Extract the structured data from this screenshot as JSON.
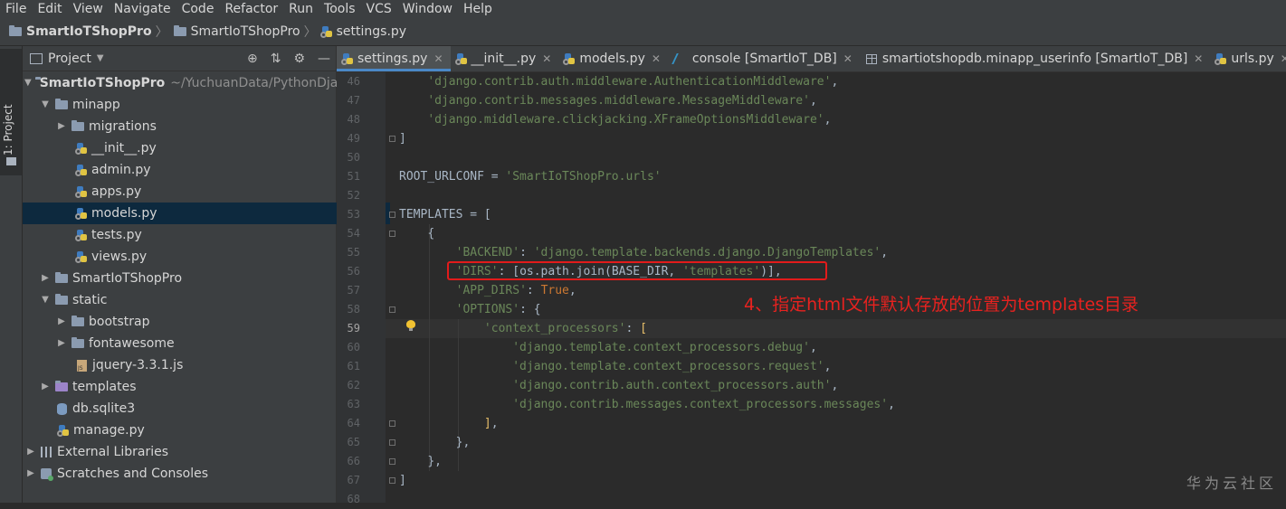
{
  "menu": [
    "File",
    "Edit",
    "View",
    "Navigate",
    "Code",
    "Refactor",
    "Run",
    "Tools",
    "VCS",
    "Window",
    "Help"
  ],
  "breadcrumb": {
    "project": "SmartIoTShopPro",
    "folder": "SmartIoTShopPro",
    "file": "settings.py"
  },
  "tool_strip": {
    "project_tab": "1: Project"
  },
  "project_panel": {
    "title": "Project",
    "root": {
      "name": "SmartIoTShopPro",
      "path": "~/YuchuanData/PythonDjan"
    },
    "items": [
      "minapp",
      "migrations",
      "__init__.py",
      "admin.py",
      "apps.py",
      "models.py",
      "tests.py",
      "views.py",
      "SmartIoTShopPro",
      "static",
      "bootstrap",
      "fontawesome",
      "jquery-3.3.1.js",
      "templates",
      "db.sqlite3",
      "manage.py",
      "External Libraries",
      "Scratches and Consoles"
    ]
  },
  "tabs": [
    "settings.py",
    "__init__.py",
    "models.py",
    "console [SmartIoT_DB]",
    "smartiotshopdb.minapp_userinfo [SmartIoT_DB]",
    "urls.py"
  ],
  "code": {
    "line_numbers": [
      "46",
      "47",
      "48",
      "49",
      "50",
      "51",
      "52",
      "53",
      "54",
      "55",
      "56",
      "57",
      "58",
      "59",
      "60",
      "61",
      "62",
      "63",
      "64",
      "65",
      "66",
      "67",
      "68"
    ],
    "l46": "'django.contrib.auth.middleware.AuthenticationMiddleware'",
    "l47": "'django.contrib.messages.middleware.MessageMiddleware'",
    "l48": "'django.middleware.clickjacking.XFrameOptionsMiddleware'",
    "l49": "]",
    "l51a": "ROOT_URLCONF = ",
    "l51b": "'SmartIoTShopPro.urls'",
    "l53": "TEMPLATES = [",
    "l54": "{",
    "l55a": "'BACKEND'",
    "l55b": "'django.template.backends.django.DjangoTemplates'",
    "l56a": "'DIRS'",
    "l56b": ": [os.path.join(BASE_DIR, ",
    "l56c": "'templates'",
    "l56d": ")],",
    "l57a": "'APP_DIRS'",
    "l57b": ": ",
    "l57c": "True",
    "l58a": "'OPTIONS'",
    "l58b": ": {",
    "l59a": "'context_processors'",
    "l59b": ": ",
    "l59c": "[",
    "l60": "'django.template.context_processors.debug'",
    "l61": "'django.template.context_processors.request'",
    "l62": "'django.contrib.auth.context_processors.auth'",
    "l63": "'django.contrib.messages.context_processors.messages'",
    "l64": "]",
    "l65": "},",
    "l66": "},",
    "l67": "]",
    "comma": ",",
    "colon": ": "
  },
  "annotation": "4、指定html文件默认存放的位置为templates目录",
  "watermark": "华为云社区",
  "colors": {
    "annotation": "#e8221f",
    "string": "#6a8759",
    "keyword": "#cc7832",
    "selection": "#0d293e",
    "accent": "#4a88c7"
  }
}
